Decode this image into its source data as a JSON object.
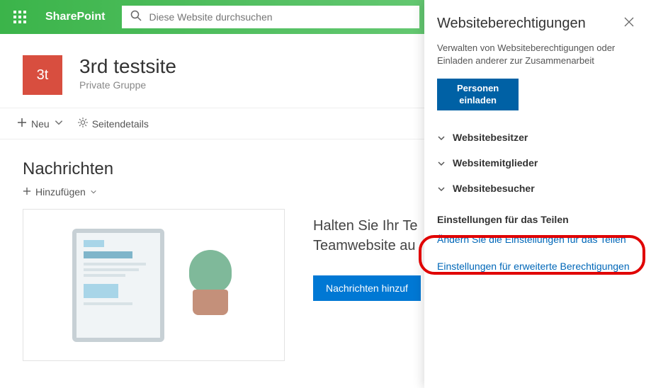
{
  "topbar": {
    "brand": "SharePoint",
    "search_placeholder": "Diese Website durchsuchen"
  },
  "site": {
    "logo_initials": "3t",
    "title": "3rd testsite",
    "subtitle": "Private Gruppe"
  },
  "commandbar": {
    "new_label": "Neu",
    "pagedetails_label": "Seitendetails"
  },
  "main": {
    "news_heading": "Nachrichten",
    "add_label": "Hinzufügen",
    "lead_line1": "Halten Sie Ihr Te",
    "lead_line2": "Teamwebsite au",
    "add_news_button": "Nachrichten hinzuf"
  },
  "panel": {
    "title": "Websiteberechtigungen",
    "description": "Verwalten von Websiteberechtigungen oder Einladen anderer zur Zusammenarbeit",
    "invite_label_line1": "Personen",
    "invite_label_line2": "einladen",
    "groups": [
      {
        "label": "Websitebesitzer"
      },
      {
        "label": "Websitemitglieder"
      },
      {
        "label": "Websitebesucher"
      }
    ],
    "sharing_title": "Einstellungen für das Teilen",
    "change_sharing_link": "Ändern Sie die Einstellungen für das Teilen",
    "advanced_perm_link": "Einstellungen für erweiterte Berechtigungen"
  }
}
